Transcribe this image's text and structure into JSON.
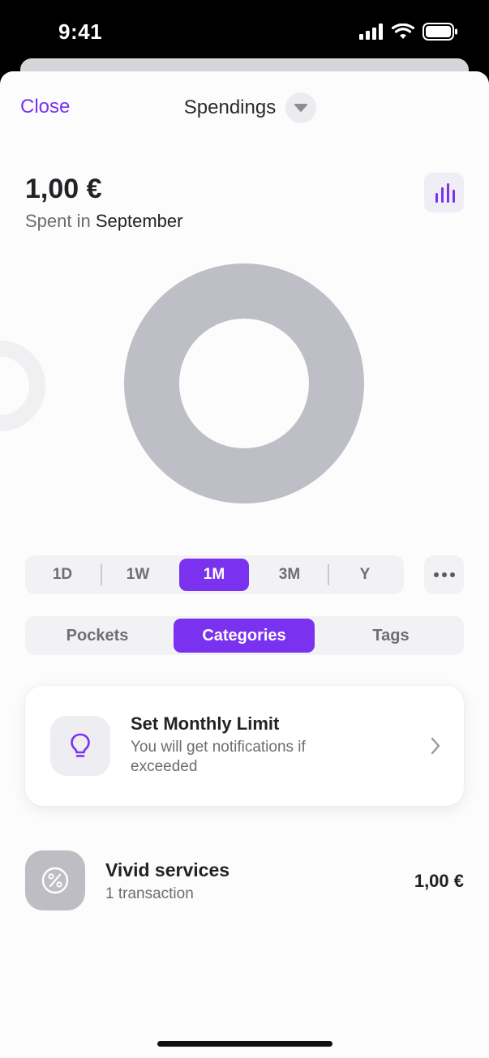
{
  "status_bar": {
    "time": "9:41"
  },
  "header": {
    "close_label": "Close",
    "title": "Spendings"
  },
  "summary": {
    "amount": "1,00 €",
    "spent_prefix": "Spent in",
    "month": "September"
  },
  "chart_data": {
    "type": "pie",
    "style": "donut",
    "slices": [
      {
        "value": 1.0,
        "color": "#bebec6"
      }
    ]
  },
  "period_tabs": {
    "items": [
      "1D",
      "1W",
      "1M",
      "3M",
      "Y"
    ],
    "active": "1M"
  },
  "group_tabs": {
    "items": [
      "Pockets",
      "Categories",
      "Tags"
    ],
    "active": "Categories"
  },
  "limit_card": {
    "title": "Set Monthly Limit",
    "description": "You will get notifications if exceeded",
    "icon": "lightbulb-icon"
  },
  "transactions": [
    {
      "name": "Vivid services",
      "count": "1 transaction",
      "amount": "1,00 €",
      "icon": "percent-icon"
    }
  ],
  "colors": {
    "accent": "#7a32f0",
    "donut": "#bebec6",
    "text": "#222226",
    "muted": "#6c6c72"
  }
}
